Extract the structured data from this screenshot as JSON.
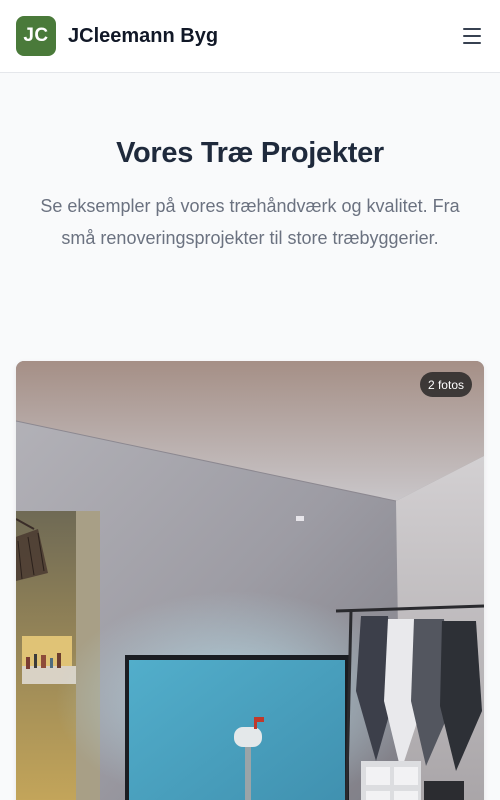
{
  "header": {
    "logo_initials": "JC",
    "brand_name": "JCleemann Byg",
    "menu_icon": "hamburger-menu-icon"
  },
  "hero": {
    "title": "Vores Træ Projekter",
    "subtitle": "Se eksempler på vores træhåndværk og kvalitet. Fra små renoveringsprojekter til store træbyggerier."
  },
  "project_card": {
    "photo_count_badge": "2 fotos"
  },
  "colors": {
    "brand_green": "#4a7a3a",
    "title_text": "#1f2a3c",
    "muted_text": "#6b7280"
  }
}
